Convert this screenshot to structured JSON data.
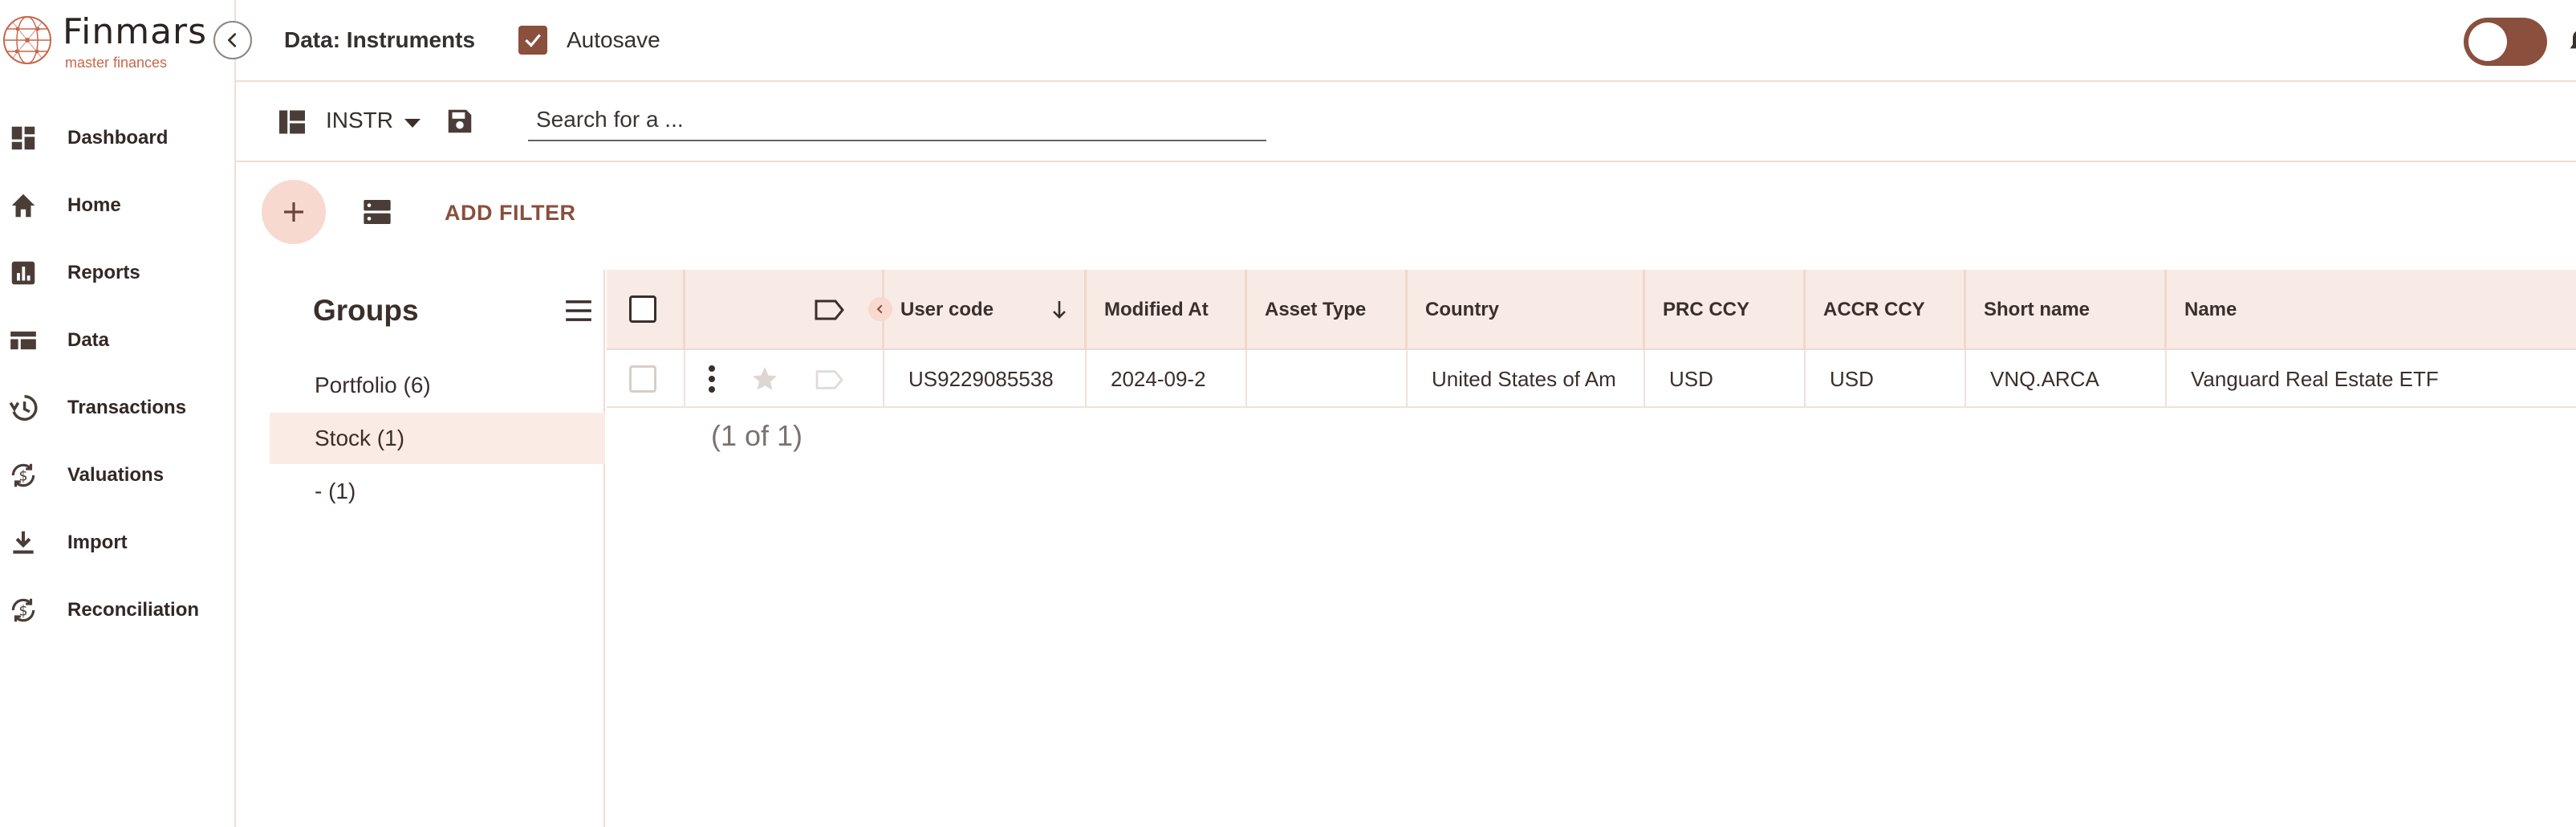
{
  "app": {
    "logo_name": "Finmars",
    "logo_sub": "master finances"
  },
  "sidebar": {
    "items": [
      {
        "label": "Dashboard",
        "icon": "dashboard-icon"
      },
      {
        "label": "Home",
        "icon": "home-icon"
      },
      {
        "label": "Reports",
        "icon": "reports-icon"
      },
      {
        "label": "Data",
        "icon": "data-icon"
      },
      {
        "label": "Transactions",
        "icon": "history-icon"
      },
      {
        "label": "Valuations",
        "icon": "dollar-sync-icon"
      },
      {
        "label": "Import",
        "icon": "download-icon"
      },
      {
        "label": "Reconciliation",
        "icon": "dollar-sync-icon"
      }
    ]
  },
  "header": {
    "title": "Data: Instruments",
    "autosave_label": "Autosave",
    "autosave_checked": true,
    "theme_toggle_on": true
  },
  "toolbar": {
    "layout_name": "INSTR",
    "search_placeholder": "Search for a ..."
  },
  "filters": {
    "add_filter_label": "ADD FILTER"
  },
  "groups": {
    "title": "Groups",
    "items": [
      {
        "label": "Portfolio (6)",
        "active": false
      },
      {
        "label": "Stock (1)",
        "active": true
      },
      {
        "label": "- (1)",
        "active": false
      }
    ]
  },
  "table": {
    "columns": [
      {
        "label": "User code",
        "sort": "desc"
      },
      {
        "label": "Modified At"
      },
      {
        "label": "Asset Type"
      },
      {
        "label": "Country"
      },
      {
        "label": "PRC CCY"
      },
      {
        "label": "ACCR CCY"
      },
      {
        "label": "Short name"
      },
      {
        "label": "Name"
      }
    ],
    "rows": [
      {
        "user_code": "US9229085538",
        "modified_at": "2024-09-2",
        "asset_type": "",
        "country": "United States of Am",
        "prc_ccy": "USD",
        "accr_ccy": "USD",
        "short_name": "VNQ.ARCA",
        "name": "Vanguard Real Estate ETF"
      }
    ],
    "pager": "(1 of 1)"
  },
  "colors": {
    "accent": "#8a4f3d",
    "accent_light": "#f7d9cf",
    "header_bg": "#f8ebe6",
    "border": "#f3dcd3"
  }
}
